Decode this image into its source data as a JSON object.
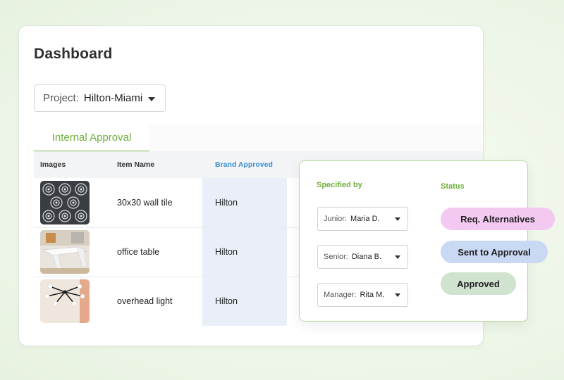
{
  "dashboard": {
    "title": "Dashboard",
    "project": {
      "label": "Project:",
      "value": "Hilton-Miami"
    },
    "tabs": [
      {
        "label": "Internal Approval",
        "active": true
      }
    ],
    "table": {
      "columns": [
        "Images",
        "Item Name",
        "Brand Approved"
      ],
      "rows": [
        {
          "image": "tile-pattern-image",
          "item_name": "30x30 wall tile",
          "brand": "Hilton"
        },
        {
          "image": "office-table-image",
          "item_name": "office table",
          "brand": "Hilton"
        },
        {
          "image": "overhead-light-image",
          "item_name": "overhead light",
          "brand": "Hilton"
        }
      ]
    }
  },
  "popup": {
    "specified_by_header": "Specified by",
    "status_header": "Status",
    "specifiers": [
      {
        "label": "Junior:",
        "value": "Maria D."
      },
      {
        "label": "Senior:",
        "value": "Diana B."
      },
      {
        "label": "Manager:",
        "value": "Rita M."
      }
    ],
    "statuses": [
      {
        "label": "Req. Alternatives",
        "color": "#f3c8f1"
      },
      {
        "label": "Sent to Approval",
        "color": "#c9d9f4"
      },
      {
        "label": "Approved",
        "color": "#cfe3cf"
      }
    ]
  },
  "colors": {
    "accent": "#6fae3d",
    "brand_header": "#3c8fd0",
    "brand_column_bg": "#e9eef9"
  }
}
